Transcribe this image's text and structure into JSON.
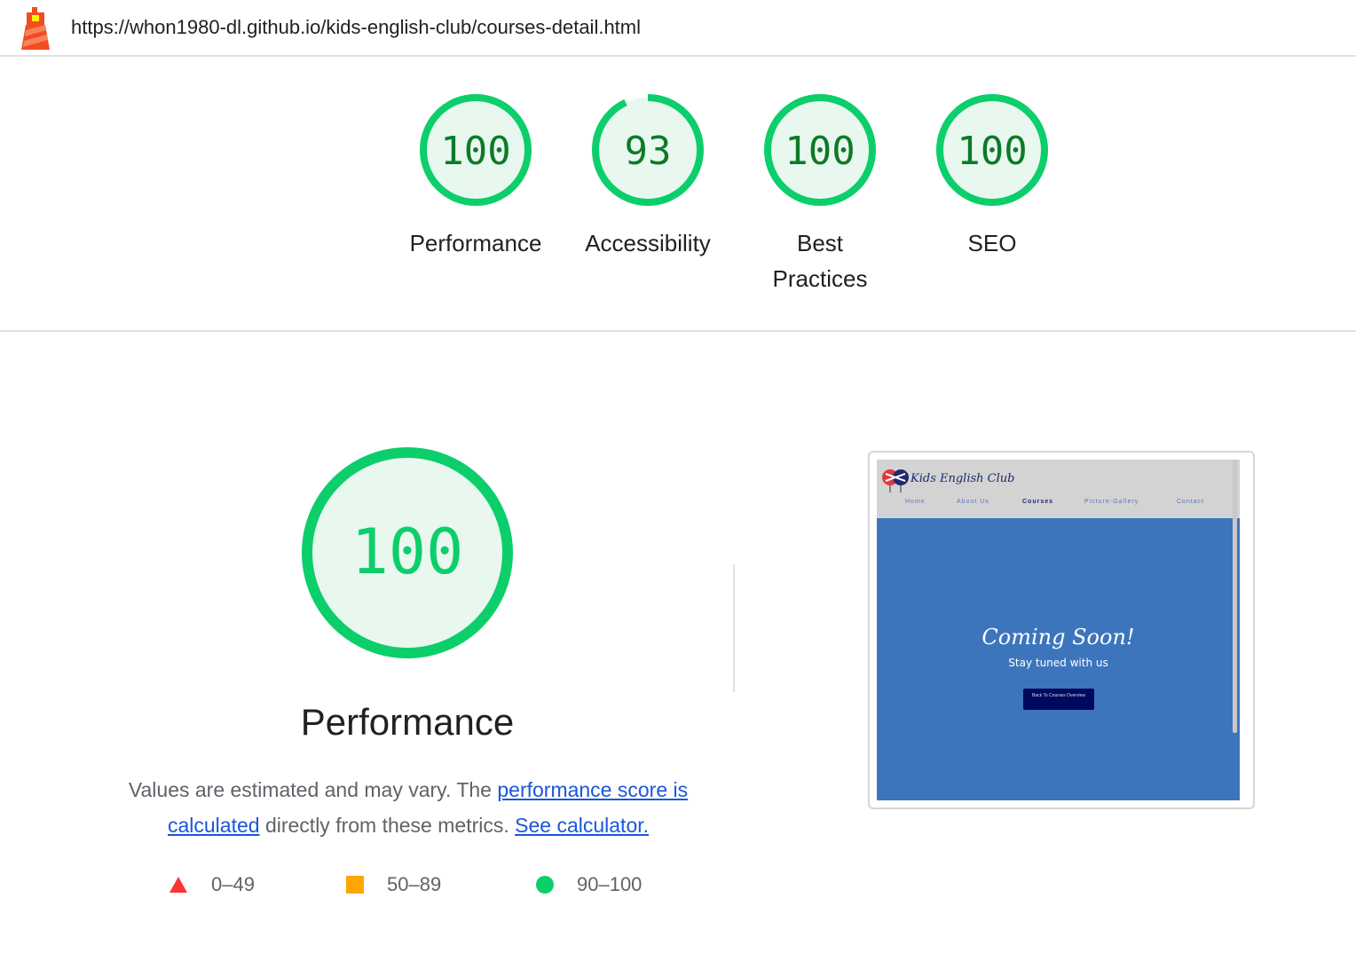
{
  "topbar": {
    "url": "https://whon1980-dl.github.io/kids-english-club/courses-detail.html",
    "logo_icon": "lighthouse-icon"
  },
  "colors": {
    "pass": "#0cce6b",
    "pass_fill": "#e8f8ee",
    "pass_text": "#0d7a29",
    "average": "#ffa400",
    "fail": "#ff3333",
    "link": "#1a56db"
  },
  "gauges": [
    {
      "score": "100",
      "label": "Performance",
      "value": 100
    },
    {
      "score": "93",
      "label": "Accessibility",
      "value": 93
    },
    {
      "score": "100",
      "label": "Best Practices",
      "value": 100
    },
    {
      "score": "100",
      "label": "SEO",
      "value": 100
    }
  ],
  "performance": {
    "score": "100",
    "value": 100,
    "title": "Performance",
    "desc_prefix": "Values are estimated and may vary. The ",
    "desc_link1": "performance score is calculated",
    "desc_mid": " directly from these metrics. ",
    "desc_link2": "See calculator.",
    "legend": [
      {
        "icon": "triangle-icon",
        "range": "0–49"
      },
      {
        "icon": "square-icon",
        "range": "50–89"
      },
      {
        "icon": "circle-icon",
        "range": "90–100"
      }
    ]
  },
  "thumbnail": {
    "brand": "Kids English Club",
    "menu": [
      "Home",
      "About Us",
      "Courses",
      "Picture-Gallery",
      "Contact"
    ],
    "active_menu": "Courses",
    "heading": "Coming Soon!",
    "subheading": "Stay tuned with us",
    "button": "Back To Courses Overview",
    "hero_color": "#3d75bd"
  }
}
